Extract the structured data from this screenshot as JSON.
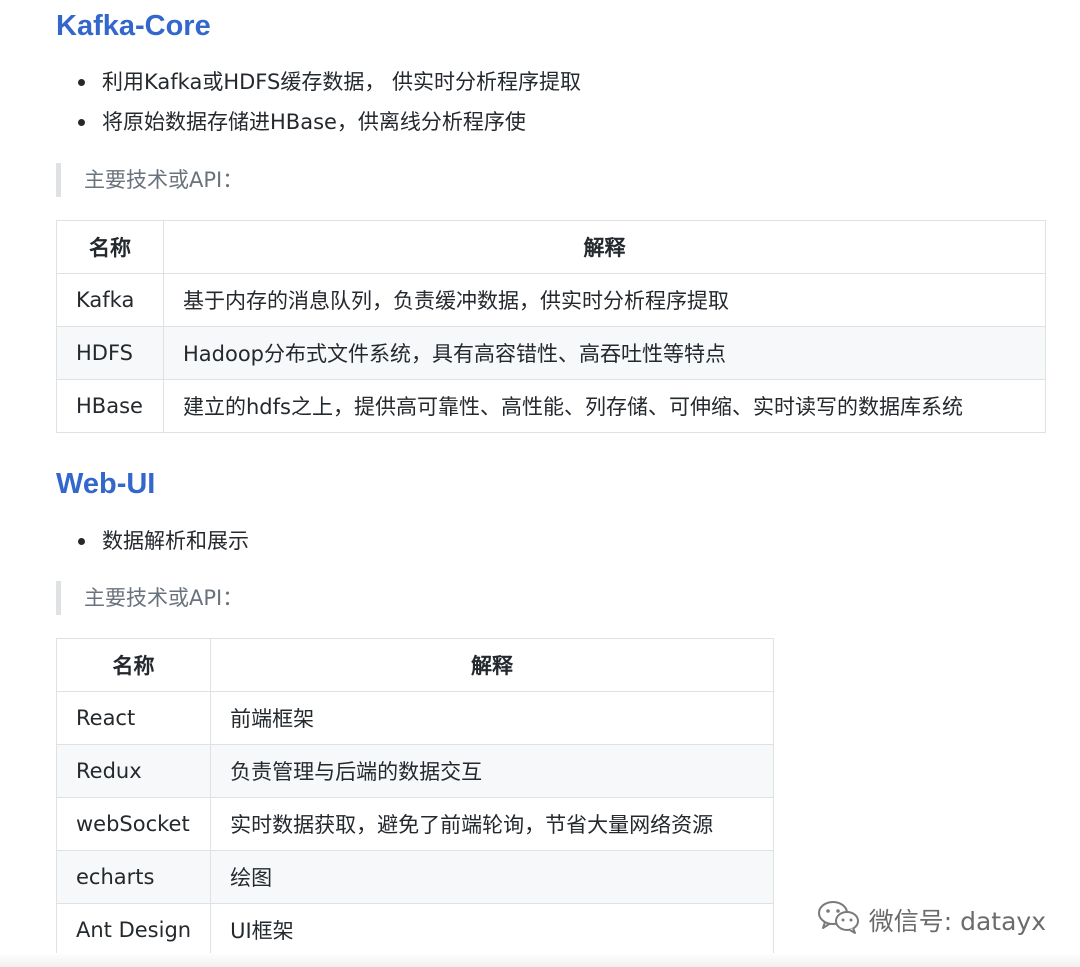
{
  "sections": [
    {
      "heading": "Kafka-Core",
      "bullets": [
        "利用Kafka或HDFS缓存数据， 供实时分析程序提取",
        "将原始数据存储进HBase，供离线分析程序使"
      ],
      "quote": "主要技术或API：",
      "table": {
        "headers": [
          "名称",
          "解释"
        ],
        "rows": [
          [
            "Kafka",
            "基于内存的消息队列，负责缓冲数据，供实时分析程序提取"
          ],
          [
            "HDFS",
            "Hadoop分布式文件系统，具有高容错性、高吞吐性等特点"
          ],
          [
            "HBase",
            "建立的hdfs之上，提供高可靠性、高性能、列存储、可伸缩、实时读写的数据库系统"
          ]
        ]
      }
    },
    {
      "heading": "Web-UI",
      "bullets": [
        "数据解析和展示"
      ],
      "quote": "主要技术或API：",
      "table": {
        "headers": [
          "名称",
          "解释"
        ],
        "rows": [
          [
            "React",
            "前端框架"
          ],
          [
            "Redux",
            "负责管理与后端的数据交互"
          ],
          [
            "webSocket",
            "实时数据获取，避免了前端轮询，节省大量网络资源"
          ],
          [
            "echarts",
            "绘图"
          ],
          [
            "Ant Design",
            "UI框架"
          ]
        ]
      }
    }
  ],
  "watermark": {
    "icon": "wechat-icon",
    "text": "微信号: datayx"
  }
}
